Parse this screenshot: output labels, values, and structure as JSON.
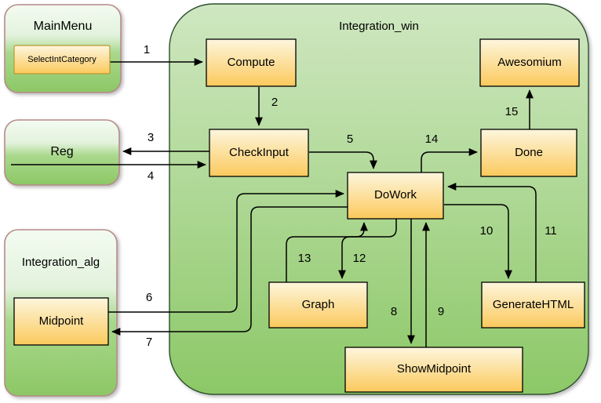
{
  "diagram": {
    "title": "Integration_win",
    "containers": [
      {
        "id": "integration_win",
        "label": "Integration_win",
        "kind": "rounded-green-panel"
      },
      {
        "id": "mainmenu",
        "label": "MainMenu",
        "kind": "rounded-green-box"
      },
      {
        "id": "reg",
        "label": "Reg",
        "kind": "rounded-green-box"
      },
      {
        "id": "integration_alg",
        "label": "Integration_alg",
        "kind": "rounded-green-box"
      }
    ],
    "nodes": [
      {
        "id": "selectintcategory",
        "label": "SelectIntCategory",
        "kind": "yellow-box",
        "font_size": 11
      },
      {
        "id": "compute",
        "label": "Compute",
        "kind": "yellow-box",
        "font_size": 15
      },
      {
        "id": "awesomium",
        "label": "Awesomium",
        "kind": "yellow-box",
        "font_size": 15
      },
      {
        "id": "checkinput",
        "label": "CheckInput",
        "kind": "yellow-box",
        "font_size": 15
      },
      {
        "id": "done",
        "label": "Done",
        "kind": "yellow-box",
        "font_size": 15
      },
      {
        "id": "dowork",
        "label": "DoWork",
        "kind": "yellow-box",
        "font_size": 15
      },
      {
        "id": "graph",
        "label": "Graph",
        "kind": "yellow-box",
        "font_size": 15
      },
      {
        "id": "generatehtml",
        "label": "GenerateHTML",
        "kind": "yellow-box",
        "font_size": 15
      },
      {
        "id": "showmidpoint",
        "label": "ShowMidpoint",
        "kind": "yellow-box",
        "font_size": 15
      },
      {
        "id": "midpoint",
        "label": "Midpoint",
        "kind": "yellow-box",
        "font_size": 15
      }
    ],
    "edges": [
      {
        "label": "1",
        "from": "selectintcategory",
        "to": "compute"
      },
      {
        "label": "2",
        "from": "compute",
        "to": "checkinput"
      },
      {
        "label": "3",
        "from": "checkinput",
        "to": "reg"
      },
      {
        "label": "4",
        "from": "reg",
        "to": "checkinput"
      },
      {
        "label": "5",
        "from": "checkinput",
        "to": "dowork"
      },
      {
        "label": "6",
        "from": "midpoint",
        "to": "dowork"
      },
      {
        "label": "7",
        "from": "dowork",
        "to": "midpoint"
      },
      {
        "label": "8",
        "from": "dowork",
        "to": "showmidpoint"
      },
      {
        "label": "9",
        "from": "showmidpoint",
        "to": "dowork"
      },
      {
        "label": "10",
        "from": "dowork",
        "to": "generatehtml"
      },
      {
        "label": "11",
        "from": "generatehtml",
        "to": "dowork"
      },
      {
        "label": "12",
        "from": "dowork",
        "to": "graph"
      },
      {
        "label": "13",
        "from": "graph",
        "to": "dowork"
      },
      {
        "label": "14",
        "from": "dowork",
        "to": "done"
      },
      {
        "label": "15",
        "from": "done",
        "to": "awesomium"
      }
    ],
    "colors": {
      "panel_fill_top": "#c9e3b9",
      "panel_fill_bottom": "#8dc96a",
      "panel_stroke": "#2f4f2f",
      "group_fill_top": "#f1faef",
      "group_fill_bottom": "#8cc765",
      "group_stroke": "#b78a8a",
      "node_fill_top": "#fdf3d3",
      "node_fill_bottom": "#fac85f",
      "node_stroke": "#000000",
      "edge_stroke": "#000000",
      "text": "#000000",
      "background": "#ffffff"
    }
  }
}
